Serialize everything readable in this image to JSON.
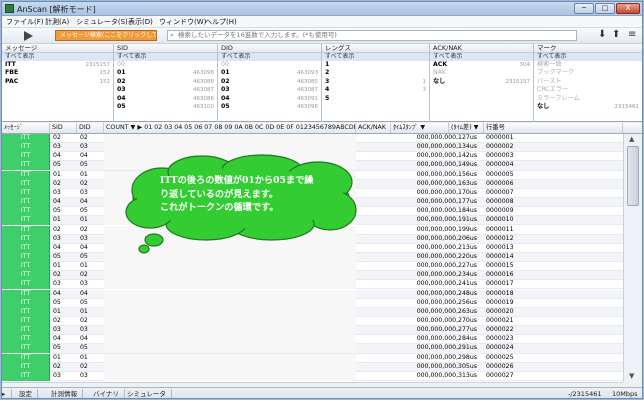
{
  "window": {
    "title": "AnScan [解析モード]",
    "min_label": "─",
    "max_label": "□",
    "close_label": "X"
  },
  "menu": [
    "ファイル(F)",
    "計測(A)",
    "シミュレータ(S)",
    "表示(D)",
    "ウィンドウ(W)",
    "ヘルプ(H)"
  ],
  "toolbar": {
    "search_mode_label": "メッセージ検索(ここをクリックして切替)",
    "search_placeholder": "検索したいデータを16進数で入力します。(*も使用可)",
    "search_icon": "magnifier-icon",
    "prev_icon": "arrow-down-icon",
    "next_icon": "arrow-up-icon",
    "menu_icon": "hamburger-icon"
  },
  "filters": [
    {
      "header": "メッセージ",
      "select_all": "すべて表示",
      "items": [
        {
          "label": "ITT",
          "count": "2315157",
          "bold": true
        },
        {
          "label": "FBE",
          "count": "152",
          "bold": true
        },
        {
          "label": "PAC",
          "count": "152",
          "bold": true
        }
      ]
    },
    {
      "header": "SID",
      "select_all": "すべて表示",
      "items": [
        {
          "label": "00",
          "count": "",
          "bold": false,
          "gray": true
        },
        {
          "label": "01",
          "count": "463098",
          "bold": true
        },
        {
          "label": "02",
          "count": "463088",
          "bold": true
        },
        {
          "label": "03",
          "count": "463087",
          "bold": true
        },
        {
          "label": "04",
          "count": "463086",
          "bold": true
        },
        {
          "label": "05",
          "count": "463100",
          "bold": true
        }
      ]
    },
    {
      "header": "DID",
      "select_all": "すべて表示",
      "items": [
        {
          "label": "00",
          "count": "",
          "bold": false,
          "gray": true
        },
        {
          "label": "01",
          "count": "463093",
          "bold": true
        },
        {
          "label": "02",
          "count": "463085",
          "bold": true
        },
        {
          "label": "03",
          "count": "463087",
          "bold": true
        },
        {
          "label": "04",
          "count": "463091",
          "bold": true
        },
        {
          "label": "05",
          "count": "463096",
          "bold": true
        }
      ]
    },
    {
      "header": "レングス",
      "select_all": "すべて表示",
      "items": [
        {
          "label": "1",
          "count": "",
          "bold": true
        },
        {
          "label": "2",
          "count": "",
          "bold": true
        },
        {
          "label": "3",
          "count": "1",
          "bold": true
        },
        {
          "label": "4",
          "count": "3",
          "bold": true
        },
        {
          "label": "5",
          "count": "",
          "bold": true
        }
      ]
    },
    {
      "header": "ACK/NAK",
      "select_all": "すべて表示",
      "items": [
        {
          "label": "ACK",
          "count": "304",
          "bold": true
        },
        {
          "label": "NAK",
          "count": "",
          "bold": false,
          "gray": true
        },
        {
          "label": "なし",
          "count": "2315157",
          "bold": true
        }
      ]
    },
    {
      "header": "マーク",
      "select_all": "すべて表示",
      "items": [
        {
          "label": "検索一致",
          "count": "",
          "bold": false,
          "gray": true
        },
        {
          "label": "ブックマーク",
          "count": "",
          "bold": false,
          "gray": true
        },
        {
          "label": "バースト",
          "count": "",
          "bold": false,
          "gray": true
        },
        {
          "label": "CRCエラー",
          "count": "",
          "bold": false,
          "gray": true
        },
        {
          "label": "ミラーフレーム",
          "count": "",
          "bold": false,
          "gray": true
        },
        {
          "label": "なし",
          "count": "2315461",
          "bold": true
        }
      ]
    }
  ],
  "grid": {
    "headers": {
      "msg": "ﾒｯｾｰｼﾞ",
      "sid": "SID",
      "did": "DID",
      "count": "COUNT ▼ ▶ 01 02 03 04 05 06 07 08 09 0A 0B 0C 0D 0E 0F  0123456789ABCDEF ▼",
      "ack": "ACK/NAK",
      "ts": "ﾀｲﾑｽﾀﾝﾌﾟ ▼",
      "diff": "(ﾀｲﾑ差) ▼",
      "line": "行番号"
    },
    "rows": [
      {
        "msg": "ITT",
        "sid": "02",
        "did": "02",
        "ts": "000,000,000,127us",
        "line": "0000001"
      },
      {
        "msg": "ITT",
        "sid": "03",
        "did": "03",
        "ts": "000,000,000,134us",
        "line": "0000002"
      },
      {
        "msg": "ITT",
        "sid": "04",
        "did": "04",
        "ts": "000,000,000,142us",
        "line": "0000003"
      },
      {
        "msg": "ITT",
        "sid": "05",
        "did": "05",
        "ts": "000,000,000,149us",
        "line": "0000004"
      },
      {
        "msg": "ITT",
        "sid": "01",
        "did": "01",
        "ts": "000,000,000,156us",
        "line": "0000005"
      },
      {
        "msg": "ITT",
        "sid": "02",
        "did": "02",
        "ts": "000,000,000,163us",
        "line": "0000006"
      },
      {
        "msg": "ITT",
        "sid": "03",
        "did": "03",
        "ts": "000,000,000,170us",
        "line": "0000007"
      },
      {
        "msg": "ITT",
        "sid": "04",
        "did": "04",
        "ts": "000,000,000,177us",
        "line": "0000008"
      },
      {
        "msg": "ITT",
        "sid": "05",
        "did": "05",
        "ts": "000,000,000,184us",
        "line": "0000009"
      },
      {
        "msg": "ITT",
        "sid": "01",
        "did": "01",
        "ts": "000,000,000,191us",
        "line": "0000010"
      },
      {
        "msg": "ITT",
        "sid": "02",
        "did": "02",
        "ts": "000,000,000,199us",
        "line": "0000011"
      },
      {
        "msg": "ITT",
        "sid": "03",
        "did": "03",
        "ts": "000,000,000,206us",
        "line": "0000012"
      },
      {
        "msg": "ITT",
        "sid": "04",
        "did": "04",
        "ts": "000,000,000,213us",
        "line": "0000013"
      },
      {
        "msg": "ITT",
        "sid": "05",
        "did": "05",
        "ts": "000,000,000,220us",
        "line": "0000014"
      },
      {
        "msg": "ITT",
        "sid": "01",
        "did": "01",
        "ts": "000,000,000,227us",
        "line": "0000015"
      },
      {
        "msg": "ITT",
        "sid": "02",
        "did": "02",
        "ts": "000,000,000,234us",
        "line": "0000016"
      },
      {
        "msg": "ITT",
        "sid": "03",
        "did": "03",
        "ts": "000,000,000,241us",
        "line": "0000017"
      },
      {
        "msg": "ITT",
        "sid": "04",
        "did": "04",
        "ts": "000,000,000,248us",
        "line": "0000018"
      },
      {
        "msg": "ITT",
        "sid": "05",
        "did": "05",
        "ts": "000,000,000,256us",
        "line": "0000019"
      },
      {
        "msg": "ITT",
        "sid": "01",
        "did": "01",
        "ts": "000,000,000,263us",
        "line": "0000020"
      },
      {
        "msg": "ITT",
        "sid": "02",
        "did": "02",
        "ts": "000,000,000,270us",
        "line": "0000021"
      },
      {
        "msg": "ITT",
        "sid": "03",
        "did": "03",
        "ts": "000,000,000,277us",
        "line": "0000022"
      },
      {
        "msg": "ITT",
        "sid": "04",
        "did": "04",
        "ts": "000,000,000,284us",
        "line": "0000023"
      },
      {
        "msg": "ITT",
        "sid": "05",
        "did": "05",
        "ts": "000,000,000,291us",
        "line": "0000024"
      },
      {
        "msg": "ITT",
        "sid": "01",
        "did": "01",
        "ts": "000,000,000,298us",
        "line": "0000025"
      },
      {
        "msg": "ITT",
        "sid": "02",
        "did": "02",
        "ts": "000,000,000,305us",
        "line": "0000026"
      },
      {
        "msg": "ITT",
        "sid": "03",
        "did": "03",
        "ts": "000,000,000,313us",
        "line": "0000027"
      }
    ]
  },
  "callout": {
    "lines": [
      "ITTの後ろの数値が01から05まで繰",
      "り返しているのが見えます。",
      "これがトークンの循環です。"
    ],
    "fill": "#33cc33"
  },
  "statusbar": {
    "tabs": [
      "設定",
      "計測情報",
      "バイナリ",
      "シミュレータ"
    ],
    "position": "-/2315461",
    "speed": "10Mbps"
  },
  "colors": {
    "msg_cell": "#3fcf6a",
    "search_mode": "#f39a3b"
  }
}
